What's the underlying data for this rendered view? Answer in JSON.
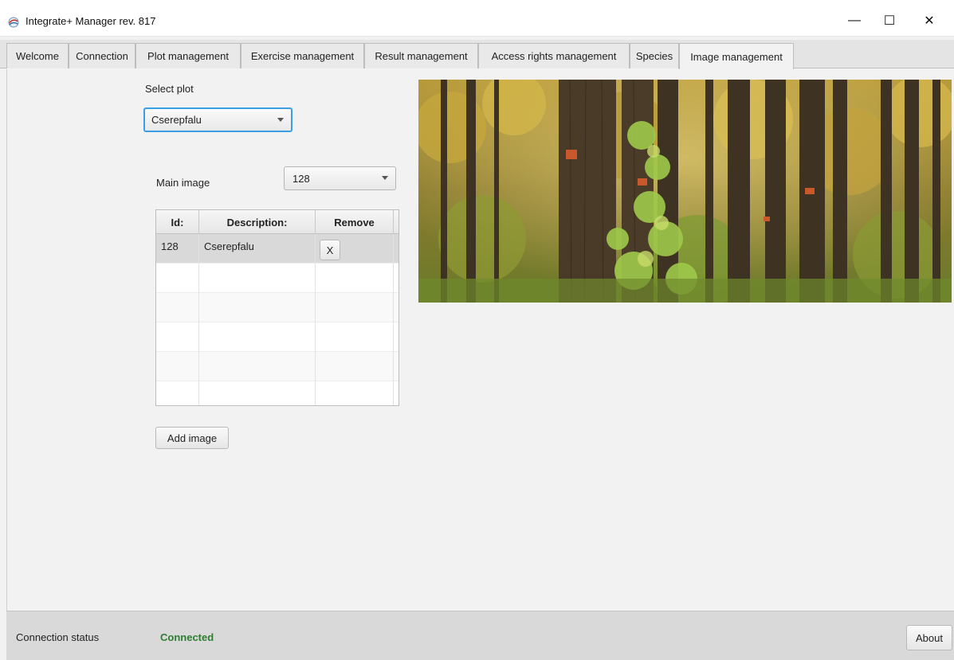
{
  "window": {
    "title": "Integrate+ Manager rev. 817",
    "minimize_glyph": "—",
    "maximize_glyph": "☐",
    "close_glyph": "✕"
  },
  "tabs": [
    {
      "label": "Welcome"
    },
    {
      "label": "Connection"
    },
    {
      "label": "Plot management"
    },
    {
      "label": "Exercise management"
    },
    {
      "label": "Result management"
    },
    {
      "label": "Access rights management"
    },
    {
      "label": "Species"
    },
    {
      "label": "Image management",
      "active": true
    }
  ],
  "plot_select": {
    "label": "Select plot",
    "value": "Cserepfalu"
  },
  "main_image": {
    "label": "Main image",
    "value": "128"
  },
  "images_table": {
    "columns": [
      "Id:",
      "Description:",
      "Remove"
    ],
    "rows": [
      {
        "id": "128",
        "description": "Cserepfalu",
        "remove_label": "X"
      }
    ]
  },
  "add_image_button": "Add image",
  "status": {
    "label": "Connection status",
    "value": "Connected",
    "value_color": "#2e7d32"
  },
  "about_button": "About",
  "colors": {
    "accent": "#3c9ee6",
    "connected": "#2e7d32"
  }
}
